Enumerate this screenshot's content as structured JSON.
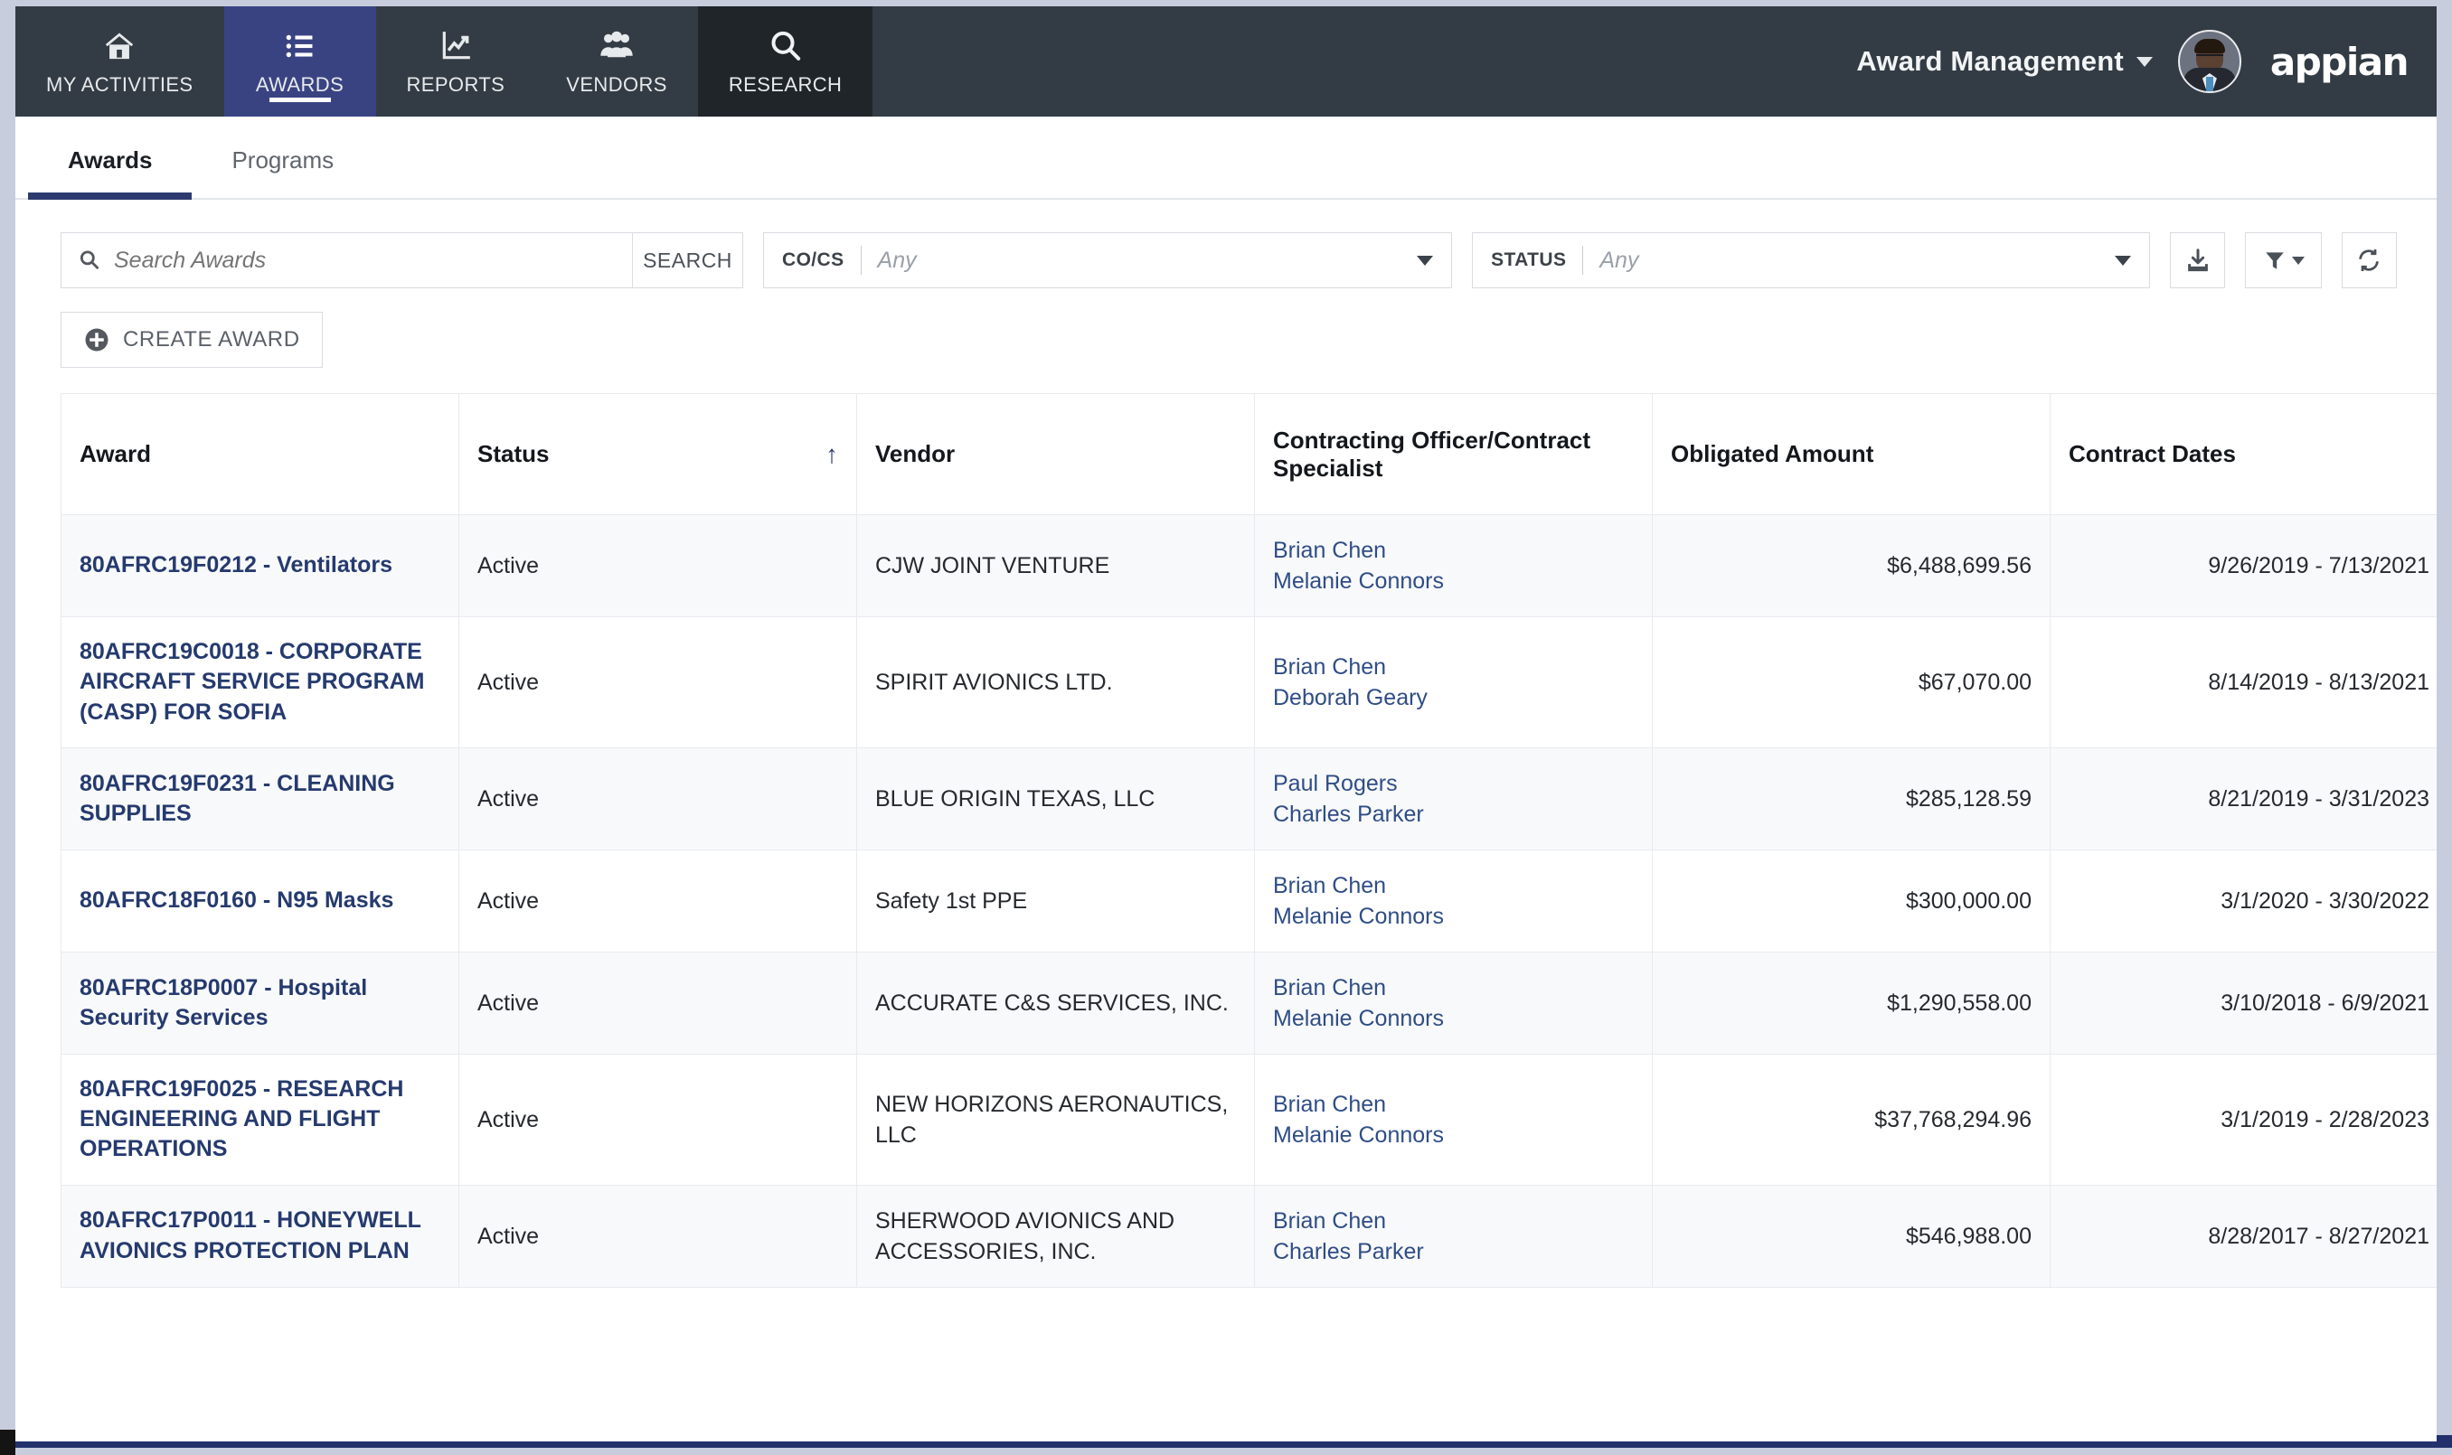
{
  "nav": {
    "items": [
      {
        "label": "MY ACTIVITIES",
        "icon": "home-icon",
        "state": "normal"
      },
      {
        "label": "AWARDS",
        "icon": "list-icon",
        "state": "active"
      },
      {
        "label": "REPORTS",
        "icon": "chart-icon",
        "state": "normal"
      },
      {
        "label": "VENDORS",
        "icon": "people-icon",
        "state": "normal"
      },
      {
        "label": "RESEARCH",
        "icon": "search-icon",
        "state": "dark"
      }
    ],
    "app_title": "Award Management",
    "brand": "appian"
  },
  "tabs": [
    {
      "label": "Awards",
      "active": true
    },
    {
      "label": "Programs",
      "active": false
    }
  ],
  "toolbar": {
    "search_placeholder": "Search Awards",
    "search_value": "",
    "search_button": "SEARCH",
    "cocs_label": "CO/CS",
    "cocs_value": "Any",
    "status_label": "STATUS",
    "status_value": "Any",
    "export_icon": "download-icon",
    "filter_icon": "funnel-icon",
    "refresh_icon": "refresh-icon",
    "create_award": "CREATE AWARD"
  },
  "grid": {
    "columns": [
      {
        "key": "award",
        "label": "Award",
        "align": "left",
        "sorted": false
      },
      {
        "key": "status",
        "label": "Status",
        "align": "left",
        "sorted": true,
        "sort_dir": "asc"
      },
      {
        "key": "vendor",
        "label": "Vendor",
        "align": "left",
        "sorted": false
      },
      {
        "key": "cocs",
        "label": "Contracting Officer/Contract Specialist",
        "align": "left",
        "sorted": false
      },
      {
        "key": "amount",
        "label": "Obligated Amount",
        "align": "right",
        "sorted": false
      },
      {
        "key": "dates",
        "label": "Contract Dates",
        "align": "right",
        "sorted": false
      }
    ],
    "rows": [
      {
        "award": "80AFRC19F0212 - Ventilators",
        "status": "Active",
        "vendor": "CJW JOINT VENTURE",
        "cocs": [
          "Brian Chen",
          "Melanie Connors"
        ],
        "amount": "$6,488,699.56",
        "dates": "9/26/2019 - 7/13/2021"
      },
      {
        "award": "80AFRC19C0018 - CORPORATE AIRCRAFT SERVICE PROGRAM (CASP) FOR SOFIA",
        "status": "Active",
        "vendor": "SPIRIT AVIONICS LTD.",
        "cocs": [
          "Brian Chen",
          "Deborah Geary"
        ],
        "amount": "$67,070.00",
        "dates": "8/14/2019 - 8/13/2021"
      },
      {
        "award": "80AFRC19F0231 - CLEANING SUPPLIES",
        "status": "Active",
        "vendor": "BLUE ORIGIN TEXAS, LLC",
        "cocs": [
          "Paul Rogers",
          "Charles Parker"
        ],
        "amount": "$285,128.59",
        "dates": "8/21/2019 - 3/31/2023"
      },
      {
        "award": "80AFRC18F0160 - N95 Masks",
        "status": "Active",
        "vendor": "Safety 1st PPE",
        "cocs": [
          "Brian Chen",
          "Melanie Connors"
        ],
        "amount": "$300,000.00",
        "dates": "3/1/2020 - 3/30/2022"
      },
      {
        "award": "80AFRC18P0007 - Hospital Security Services",
        "status": "Active",
        "vendor": "ACCURATE C&S SERVICES, INC.",
        "cocs": [
          "Brian Chen",
          "Melanie Connors"
        ],
        "amount": "$1,290,558.00",
        "dates": "3/10/2018 - 6/9/2021"
      },
      {
        "award": "80AFRC19F0025 - RESEARCH ENGINEERING AND FLIGHT OPERATIONS",
        "status": "Active",
        "vendor": "NEW HORIZONS AERONAUTICS, LLC",
        "cocs": [
          "Brian Chen",
          "Melanie Connors"
        ],
        "amount": "$37,768,294.96",
        "dates": "3/1/2019 - 2/28/2023"
      },
      {
        "award": "80AFRC17P0011 - HONEYWELL AVIONICS PROTECTION PLAN",
        "status": "Active",
        "vendor": "SHERWOOD AVIONICS AND ACCESSORIES, INC.",
        "cocs": [
          "Brian Chen",
          "Charles Parker"
        ],
        "amount": "$546,988.00",
        "dates": "8/28/2017 - 8/27/2021"
      }
    ]
  },
  "colors": {
    "navbar": "#333c44",
    "nav_active": "#3a4382",
    "nav_dark": "#20252a",
    "tab_accent": "#2d3a70",
    "link": "#253a6e",
    "person_link": "#2f4d86",
    "page_edge": "#c8cddd",
    "bottom_bar": "#22306b"
  }
}
